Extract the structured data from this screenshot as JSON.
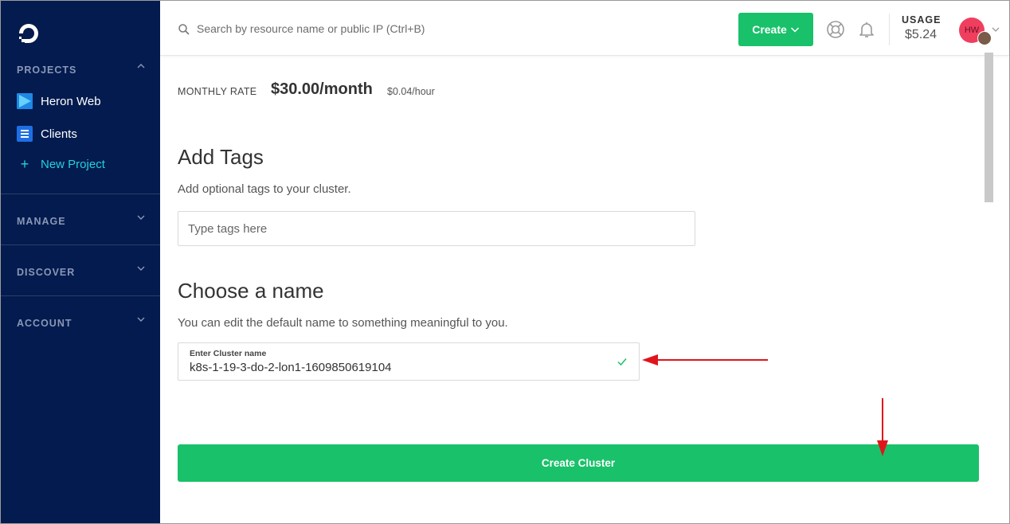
{
  "sidebar": {
    "projects_label": "PROJECTS",
    "projects": [
      {
        "label": "Heron Web",
        "icon": "play-triangle-icon"
      },
      {
        "label": "Clients",
        "icon": "list-icon"
      }
    ],
    "new_project_label": "New Project",
    "sections": [
      "MANAGE",
      "DISCOVER",
      "ACCOUNT"
    ]
  },
  "header": {
    "search_placeholder": "Search by resource name or public IP (Ctrl+B)",
    "create_label": "Create",
    "usage_label": "USAGE",
    "usage_value": "$5.24",
    "avatar_initials": "HW"
  },
  "pricing": {
    "label": "MONTHLY RATE",
    "monthly": "$30.00/month",
    "hourly": "$0.04/hour"
  },
  "tags": {
    "title": "Add Tags",
    "description": "Add optional tags to your cluster.",
    "placeholder": "Type tags here"
  },
  "name": {
    "title": "Choose a name",
    "description": "You can edit the default name to something meaningful to you.",
    "field_label": "Enter Cluster name",
    "field_value": "k8s-1-19-3-do-2-lon1-1609850619104"
  },
  "submit": {
    "label": "Create Cluster"
  },
  "colors": {
    "sidebar_bg": "#031b4e",
    "accent_green": "#19c16a",
    "new_project": "#24d0de",
    "annotation_arrow": "#e0151b"
  }
}
